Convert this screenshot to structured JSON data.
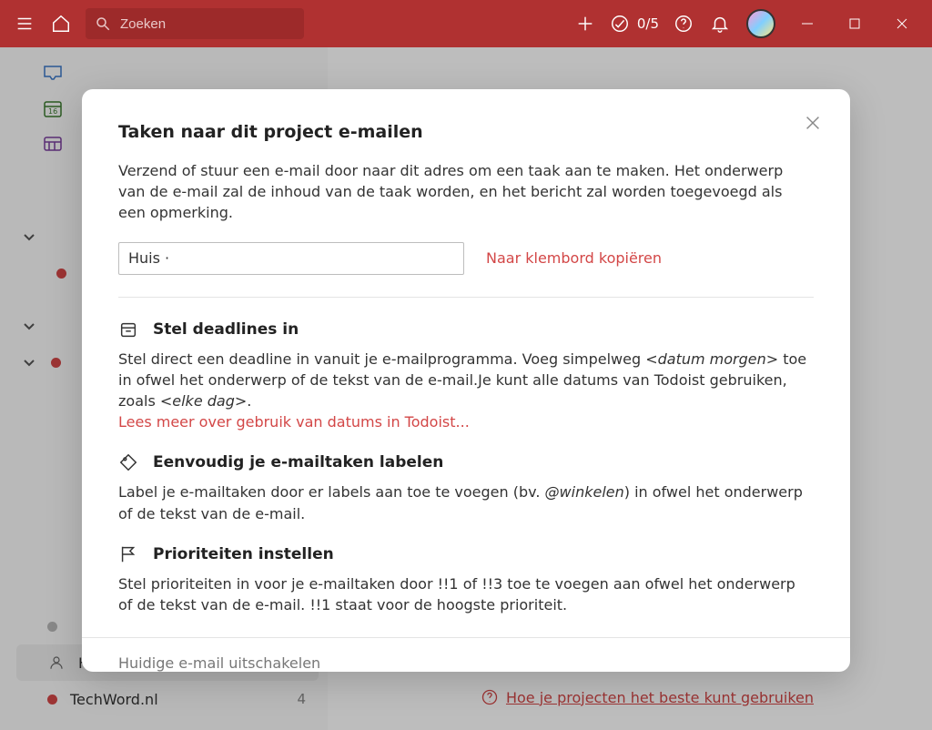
{
  "topbar": {
    "search_placeholder": "Zoeken",
    "counter": "0/5"
  },
  "sidebar": {
    "huis": "Huis",
    "techword": "TechWord.nl",
    "techword_badge": "4"
  },
  "help_link": "Hoe je projecten het beste kunt gebruiken",
  "dialog": {
    "title": "Taken naar dit project e-mailen",
    "description": "Verzend of stuur een e-mail door naar dit adres om een taak aan te maken. Het onderwerp van de e-mail zal de inhoud van de taak worden, en het bericht zal worden toegevoegd als een opmerking.",
    "email_value": "Huis ·",
    "copy_label": "Naar klembord kopiëren",
    "tip1_title": "Stel deadlines in",
    "tip1_body_a": "Stel direct een deadline in vanuit je e-mailprogramma. Voeg simpelweg <",
    "tip1_body_em1": "datum morgen",
    "tip1_body_b": "> toe in ofwel het onderwerp of de tekst van de e-mail.Je kunt alle datums van Todoist gebruiken, zoals <",
    "tip1_body_em2": "elke dag",
    "tip1_body_c": ">.",
    "tip1_link": "Lees meer over gebruik van datums in Todoist...",
    "tip2_title": "Eenvoudig je e-mailtaken labelen",
    "tip2_body_a": "Label je e-mailtaken door er labels aan toe te voegen (bv. ",
    "tip2_body_em": "@winkelen",
    "tip2_body_b": ") in ofwel het onderwerp of de tekst van de e-mail.",
    "tip3_title": "Prioriteiten instellen",
    "tip3_body": "Stel prioriteiten in voor je e-mailtaken door !!1 of !!3 toe te voegen aan ofwel het onderwerp of de tekst van de e-mail. !!1 staat voor de hoogste prioriteit.",
    "footer": "Huidige e-mail uitschakelen"
  }
}
